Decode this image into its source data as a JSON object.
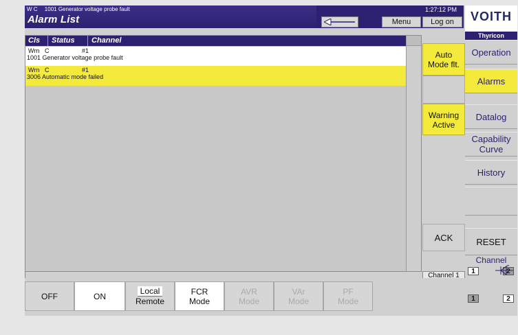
{
  "header": {
    "msg_code": "W C",
    "msg_text": "1001 Generator voltage probe fault",
    "title": "Alarm List",
    "menu_label": "Menu",
    "time": "1:27:12 PM",
    "logon_label": "Log on",
    "brand": "VOITH",
    "sub_brand": "Thyricon"
  },
  "alarm_list": {
    "columns": [
      "Cls",
      "Status",
      "Channel"
    ],
    "rows": [
      {
        "cls": "Wrn",
        "status": "C",
        "channel": "#1",
        "text": "1001 Generator voltage probe fault",
        "bg": "#ffffff"
      },
      {
        "cls": "Wrn",
        "status": "C",
        "channel": "#1",
        "text": "3006 Automatic mode failed",
        "bg": "#f3ea3b"
      }
    ]
  },
  "indicators": {
    "auto_mode_line1": "Auto",
    "auto_mode_line2": "Mode flt.",
    "warning_line1": "Warning",
    "warning_line2": "Active",
    "ack_label": "ACK",
    "channel_label": "Channel 1"
  },
  "nav": {
    "operation": "Operation",
    "alarms": "Alarms",
    "datalog": "Datalog",
    "capability_line1": "Capability",
    "capability_line2": "Curve",
    "history": "History",
    "reset": "RESET",
    "channel": "Channel",
    "ch1": "1",
    "ch2": "2",
    "bottom_ch1": "1",
    "bottom_ch2": "2"
  },
  "bottom_bar": {
    "off": "OFF",
    "on": "ON",
    "local": "Local",
    "remote": "Remote",
    "fcr_line1": "FCR",
    "fcr_line2": "Mode",
    "avr_line1": "AVR",
    "avr_line2": "Mode",
    "var_line1": "VAr",
    "var_line2": "Mode",
    "pf_line1": "PF",
    "pf_line2": "Mode"
  },
  "colors": {
    "header_blue": "#2b2170",
    "warning_yellow": "#f3ea3b"
  }
}
